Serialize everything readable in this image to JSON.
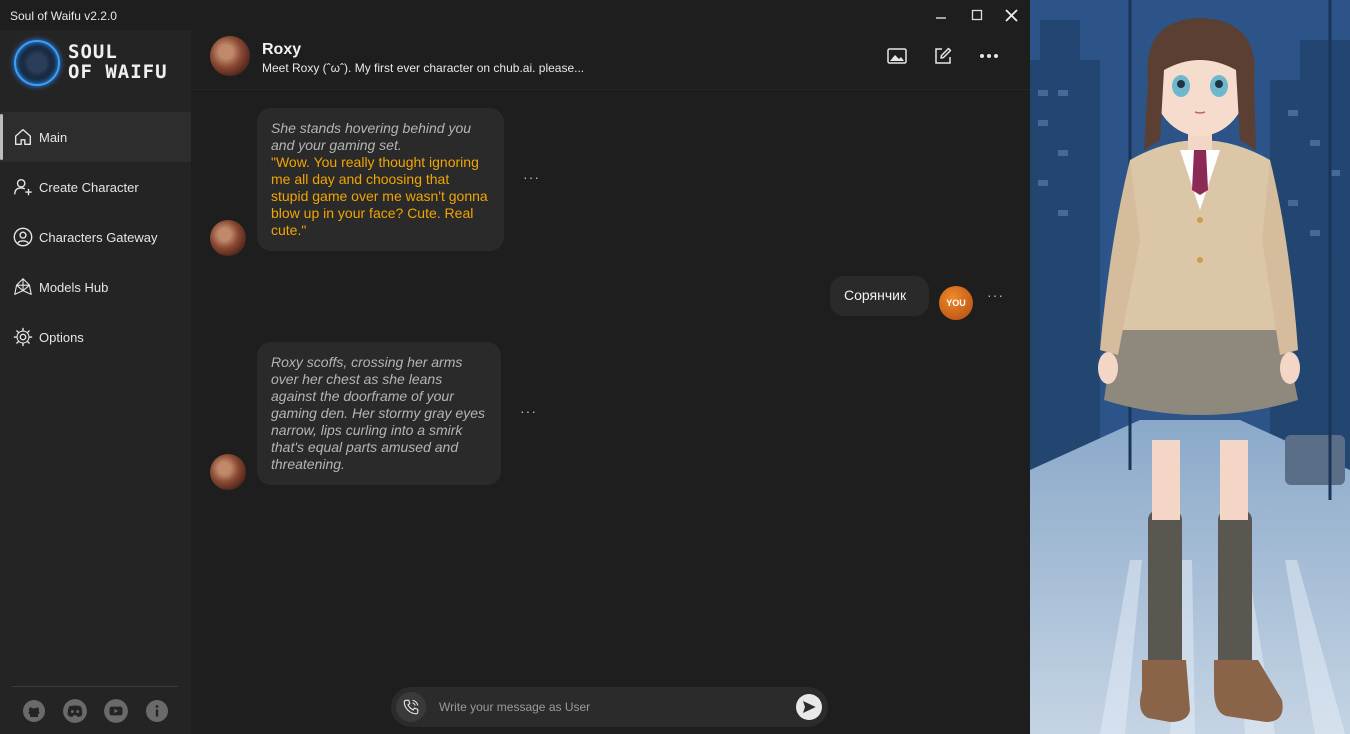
{
  "window": {
    "title": "Soul of Waifu v2.2.0"
  },
  "sidebar": {
    "logo_line1": "SOUL",
    "logo_line2": "OF WAIFU",
    "items": [
      {
        "label": "Main",
        "icon": "home-icon",
        "active": true
      },
      {
        "label": "Create Character",
        "icon": "user-plus-icon",
        "active": false
      },
      {
        "label": "Characters Gateway",
        "icon": "users-circle-icon",
        "active": false
      },
      {
        "label": "Models Hub",
        "icon": "mesh-icon",
        "active": false
      },
      {
        "label": "Options",
        "icon": "settings-icon",
        "active": false
      }
    ],
    "social": [
      "github-icon",
      "discord-icon",
      "youtube-icon",
      "info-icon"
    ]
  },
  "header": {
    "character_name": "Roxy",
    "description": "Meet Roxy (ˆωˆ). My first ever character on chub.ai. please..."
  },
  "messages": [
    {
      "author": "character",
      "narration": "She stands hovering behind you and your gaming set.",
      "speech": "\"Wow. You really thought ignoring me all day and choosing that stupid game over me wasn't gonna blow up in your face? Cute. Real cute.\""
    },
    {
      "author": "user",
      "text": "Сорянчик",
      "avatar_label": "YOU"
    },
    {
      "author": "character",
      "narration": "Roxy scoffs, crossing her arms over her chest as she leans against the doorframe of your gaming den. Her stormy gray eyes narrow, lips curling into a smirk that's equal parts amused and threatening.",
      "speech": ""
    }
  ],
  "message_menu": "···",
  "input": {
    "placeholder": "Write your message as User"
  },
  "colors": {
    "speech": "#f0a500",
    "narration": "#b5b5b5",
    "bubble": "#2a2a2a",
    "sidebar": "#242424"
  }
}
